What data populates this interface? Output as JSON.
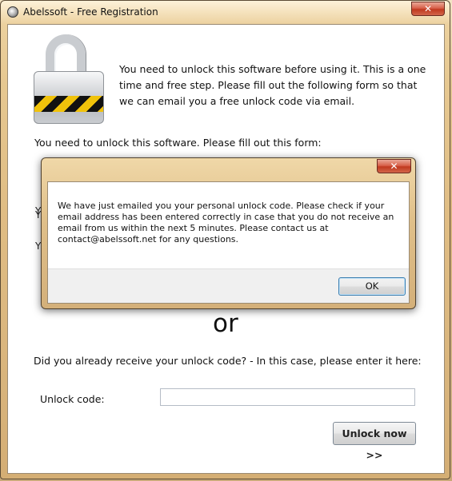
{
  "window": {
    "title": "Abelssoft - Free Registration",
    "close_glyph": "✕"
  },
  "intro_text": "You need to unlock this software before using it. This is a one time and free step. Please fill out the following form so that we can email you a free unlock code via email.",
  "form_prompt": "You need to unlock this software. Please fill out this form:",
  "hidden_fields": [
    {
      "label": "Y"
    },
    {
      "label": "Y"
    },
    {
      "label": "Y"
    }
  ],
  "separator_text": "or",
  "code_question": "Did you already receive your unlock code? - In this case, please enter it here:",
  "unlock_code": {
    "label": "Unlock code:",
    "value": "",
    "placeholder": ""
  },
  "unlock_button_label": "Unlock now >>",
  "dialog": {
    "close_glyph": "✕",
    "message": "We have just emailed you your personal unlock code. Please check if your email address has been entered correctly in case that you do not receive an email from us within the next 5 minutes. Please contact us at contact@abelssoft.net for any questions.",
    "ok_label": "OK"
  },
  "colors": {
    "close_button": "#c7432a",
    "stripe_yellow": "#f0c20a",
    "stripe_black": "#111111",
    "accent_focus": "#3c7fb1"
  }
}
